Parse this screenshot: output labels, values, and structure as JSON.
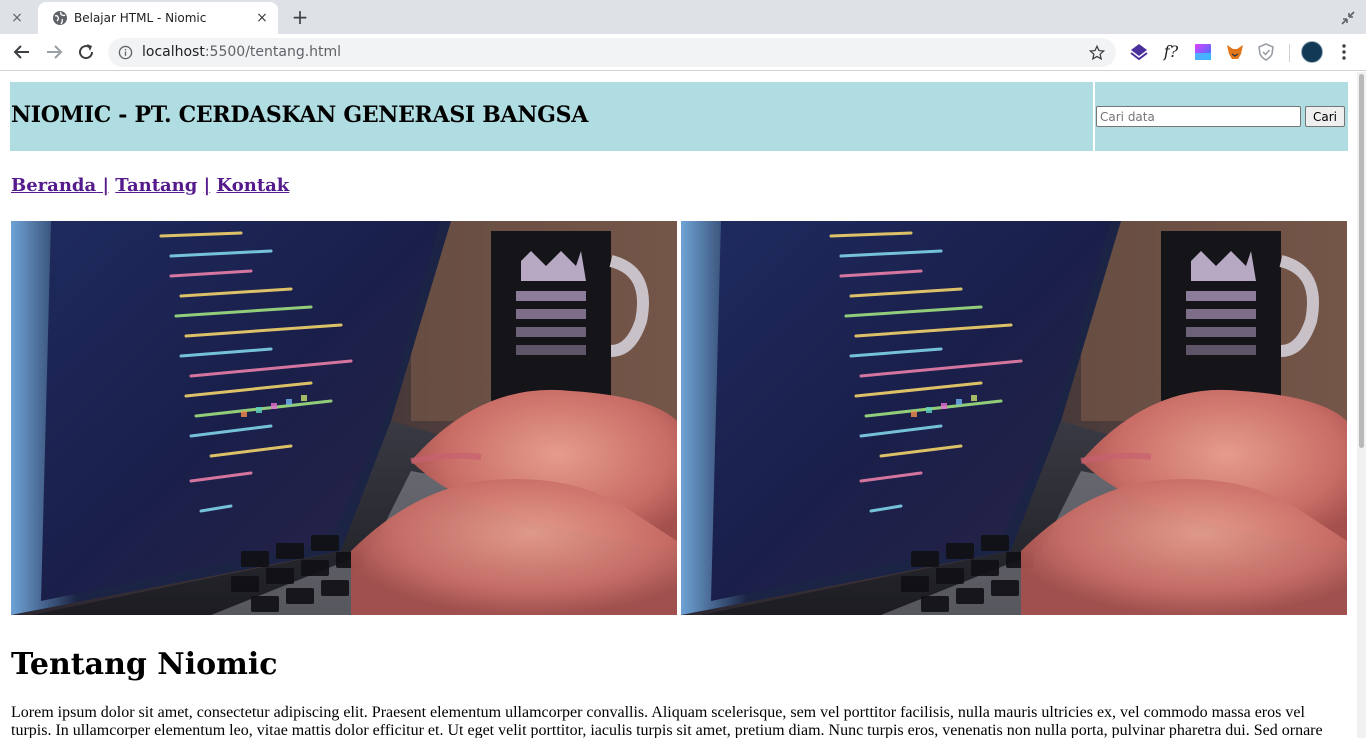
{
  "browser": {
    "tab_title": "Belajar HTML - Niomic",
    "url_host": "localhost",
    "url_rest": ":5500/tentang.html",
    "tab_close_glyph": "×",
    "new_tab_glyph": "+",
    "icons": [
      "close-icon",
      "globe-icon",
      "plus-icon",
      "restore-icon",
      "back-arrow-icon",
      "forward-arrow-icon",
      "reload-icon",
      "info-icon",
      "star-icon",
      "extension-stack-icon",
      "function-icon",
      "gradient-square-icon",
      "fox-icon",
      "shield-icon",
      "profile-avatar",
      "more-vert-icon"
    ],
    "extension_f_label": "f?"
  },
  "page": {
    "header": {
      "title": "NIOMIC - PT. CERDASKAN GENERASI BANGSA",
      "search_placeholder": "Cari data",
      "search_button": "Cari",
      "background": "#b0dde2"
    },
    "nav": {
      "items": [
        "Beranda",
        "Tantang",
        "Kontak"
      ],
      "separator": "|",
      "link_color": "#551a8b"
    },
    "hero_images": [
      "laptop-coding-photo",
      "laptop-coding-photo"
    ],
    "about": {
      "heading": "Tentang Niomic",
      "paragraph": "Lorem ipsum dolor sit amet, consectetur adipiscing elit. Praesent elementum ullamcorper convallis. Aliquam scelerisque, sem vel porttitor facilisis, nulla mauris ultricies ex, vel commodo massa eros vel turpis. In ullamcorper elementum leo, vitae mattis dolor efficitur et. Ut eget velit porttitor, iaculis turpis sit amet, pretium diam. Nunc turpis eros, venenatis non nulla porta, pulvinar pharetra dui. Sed ornare"
    }
  }
}
